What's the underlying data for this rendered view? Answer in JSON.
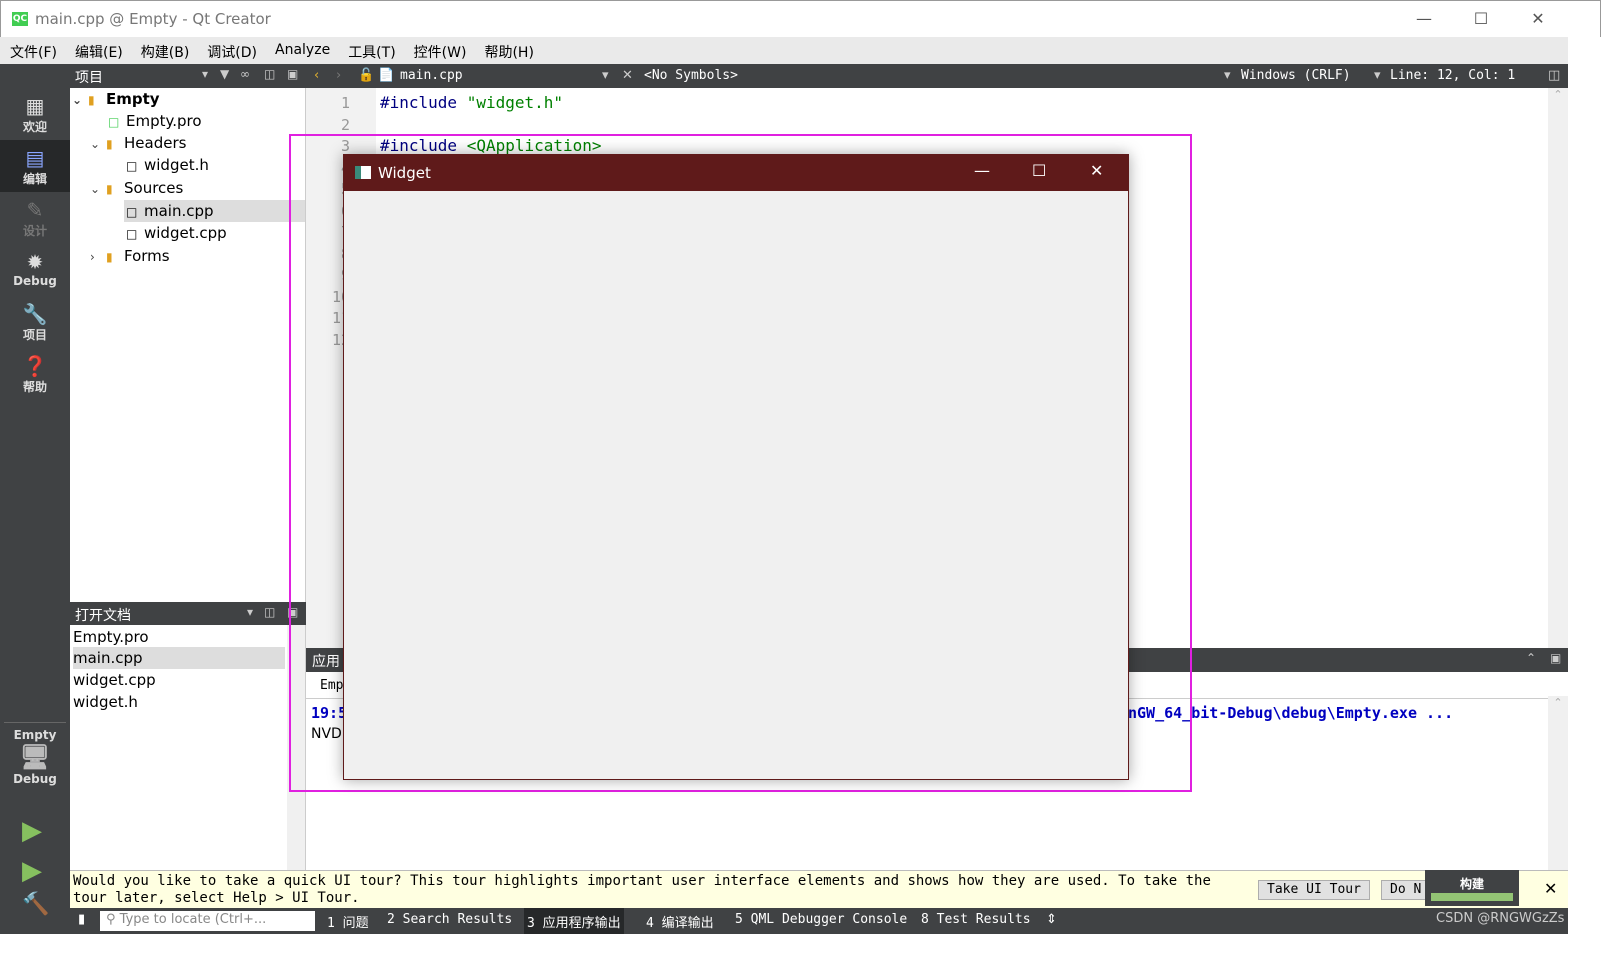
{
  "window": {
    "title": "main.cpp @ Empty - Qt Creator",
    "logo": "QC"
  },
  "menu": [
    "文件(F)",
    "编辑(E)",
    "构建(B)",
    "调试(D)",
    "Analyze",
    "工具(T)",
    "控件(W)",
    "帮助(H)"
  ],
  "modes": [
    {
      "label": "欢迎",
      "icon": "grid-icon"
    },
    {
      "label": "编辑",
      "icon": "edit-icon"
    },
    {
      "label": "设计",
      "icon": "pencil-icon"
    },
    {
      "label": "Debug",
      "icon": "bug-icon"
    },
    {
      "label": "项目",
      "icon": "wrench-icon"
    },
    {
      "label": "帮助",
      "icon": "help-icon"
    }
  ],
  "kit": {
    "project": "Empty",
    "config": "Debug"
  },
  "project_panel": {
    "title": "项目",
    "tree": [
      {
        "label": "Empty",
        "level": 0,
        "arrow": "down",
        "bold": true
      },
      {
        "label": "Empty.pro",
        "level": 1
      },
      {
        "label": "Headers",
        "level": 1,
        "arrow": "down"
      },
      {
        "label": "widget.h",
        "level": 2
      },
      {
        "label": "Sources",
        "level": 1,
        "arrow": "down"
      },
      {
        "label": "main.cpp",
        "level": 2,
        "selected": true
      },
      {
        "label": "widget.cpp",
        "level": 2
      },
      {
        "label": "Forms",
        "level": 1,
        "arrow": "right"
      }
    ]
  },
  "open_docs": {
    "title": "打开文档",
    "items": [
      "Empty.pro",
      "main.cpp",
      "widget.cpp",
      "widget.h"
    ],
    "selected": "main.cpp"
  },
  "editor": {
    "file": "main.cpp",
    "symbols": "<No Symbols>",
    "line_ending": "Windows (CRLF)",
    "position": "Line: 12, Col: 1",
    "line_numbers": [
      "1",
      "2",
      "3",
      "4",
      "5",
      "6",
      "7",
      "8",
      "9",
      "10",
      "11",
      "12"
    ],
    "code": [
      {
        "kw": "#include",
        "arg": " \"widget.h\""
      },
      {
        "kw": "",
        "arg": ""
      },
      {
        "kw": "#include",
        "arg": " <QApplication>"
      }
    ]
  },
  "output": {
    "title": "应用",
    "tab": "Emp",
    "time": "19:5",
    "path_tail": "nGW_64_bit-Debug\\debug\\Empty.exe ...",
    "line2": "NVD"
  },
  "tour": {
    "message": "Would you like to take a quick UI tour? This tour highlights important user interface elements and shows how they are used. To take the tour later, select Help > UI Tour.",
    "take": "Take UI Tour",
    "dont": "Do N",
    "dont_tail": "n"
  },
  "status": {
    "locate_placeholder": "Type to locate (Ctrl+...",
    "panes": [
      "1 问题",
      "2 Search Results",
      "3 应用程序输出",
      "4 编译输出",
      "5 QML Debugger Console",
      "8 Test Results"
    ]
  },
  "build": {
    "label": "构建",
    "progress": 1.0,
    "color": "#93c474"
  },
  "widget": {
    "title": "Widget",
    "titlebar_color": "#5f1a1a"
  },
  "highlight_color": "#e020e0",
  "watermark": "CSDN @RNGWGzZs"
}
